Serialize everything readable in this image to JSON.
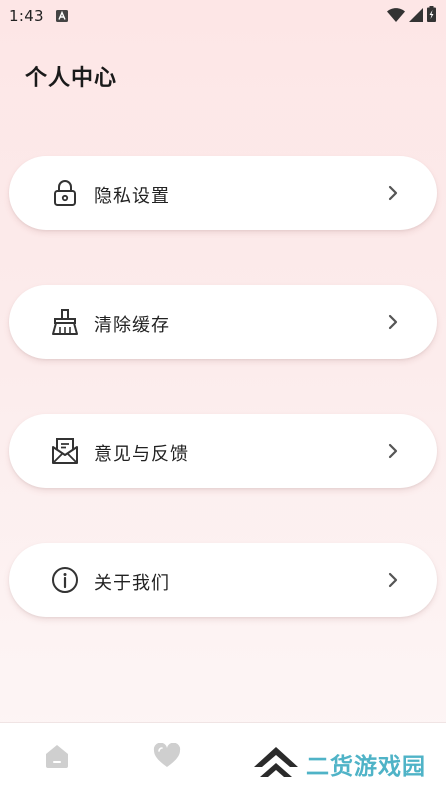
{
  "status": {
    "time": "1:43"
  },
  "page": {
    "title": "个人中心"
  },
  "menu": [
    {
      "label": "隐私设置",
      "icon": "lock-icon"
    },
    {
      "label": "清除缓存",
      "icon": "broom-icon"
    },
    {
      "label": "意见与反馈",
      "icon": "mail-icon"
    },
    {
      "label": "关于我们",
      "icon": "info-icon"
    }
  ],
  "nav": [
    {
      "icon": "home-icon"
    },
    {
      "icon": "heart-icon"
    }
  ],
  "watermark": {
    "text": "二货游戏园"
  },
  "colors": {
    "card": "#ffffff",
    "accent": "#4fb3c7",
    "icon": "#333333",
    "nav_icon": "#cfcfcf"
  }
}
